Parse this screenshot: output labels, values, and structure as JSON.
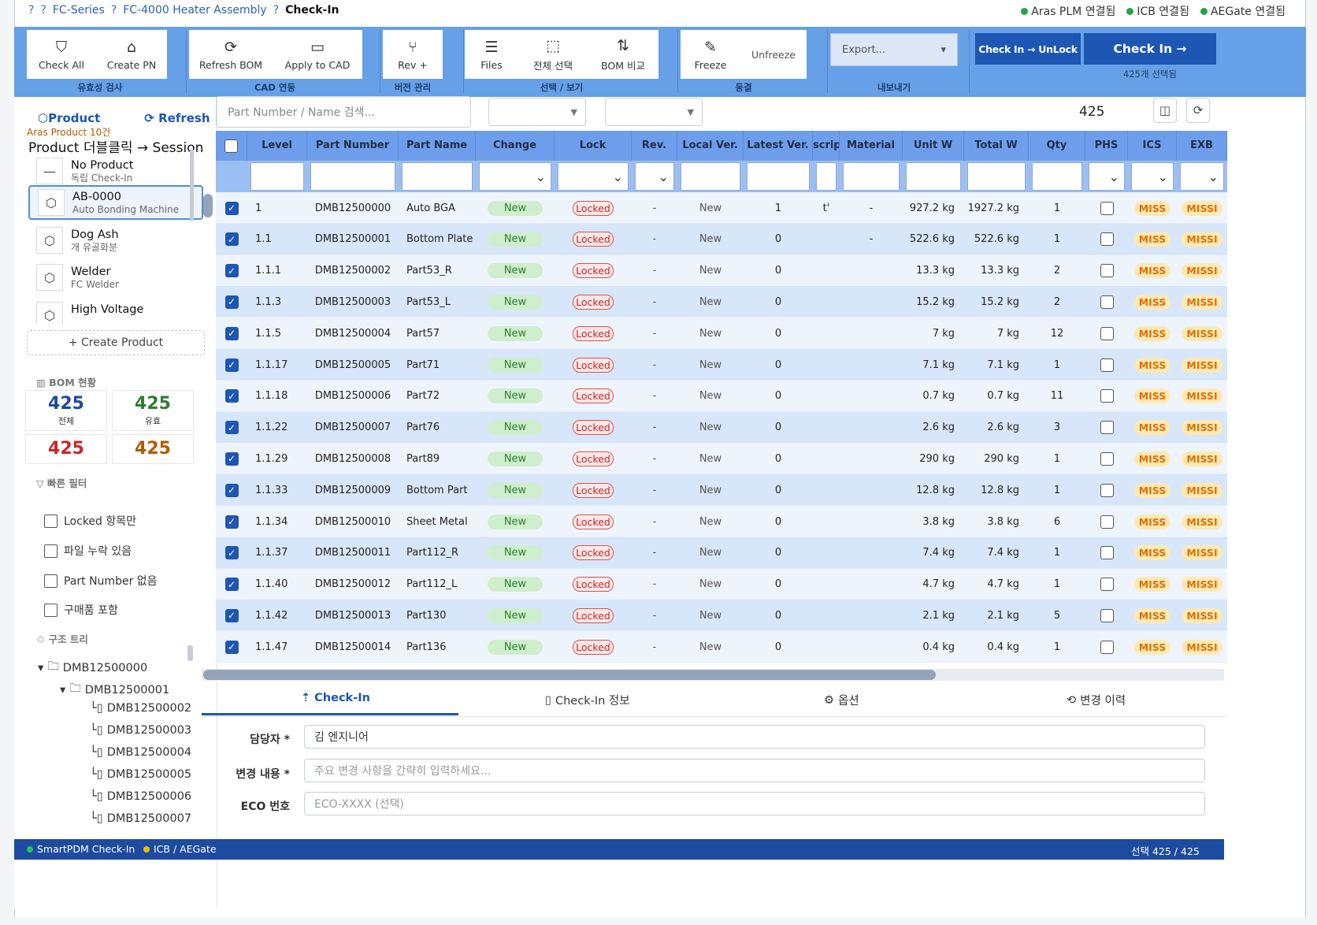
{
  "breadcrumb": {
    "sep": "?",
    "items": [
      "FC-Series",
      "FC-4000 Heater Assembly"
    ],
    "current": "Check-In"
  },
  "connections": [
    {
      "label": "Aras PLM 연결됨",
      "color": "#22a447"
    },
    {
      "label": "ICB 연결됨",
      "color": "#22a447"
    },
    {
      "label": "AEGate 연결됨",
      "color": "#22a447"
    }
  ],
  "ribbon": {
    "validity": {
      "label": "유효성 검사",
      "check_all": "Check All",
      "create_pn": "Create PN"
    },
    "cad": {
      "label": "CAD 연동",
      "refresh_bom": "Refresh BOM",
      "apply_cad": "Apply to CAD"
    },
    "version": {
      "label": "버전 관리",
      "rev_plus": "Rev +"
    },
    "view": {
      "label": "선택 / 보기",
      "files": "Files",
      "select_all": "전체 선택",
      "bom_compare": "BOM 비교"
    },
    "freeze": {
      "label": "동결",
      "freeze": "Freeze",
      "unfreeze": "Unfreeze"
    },
    "export": {
      "label": "내보내기",
      "value": "Export..."
    },
    "checkin_unlock": "Check In → UnLock",
    "checkin": "Check In →",
    "selected_note": "425개 선택됨"
  },
  "sidebar": {
    "product_btn": "Product",
    "refresh_btn": "Refresh",
    "product_count": "Aras Product 10건",
    "hint": "Product 더블클릭 → Session",
    "products": [
      {
        "name": "No Product",
        "desc": "독립 Check-In",
        "icon": "—"
      },
      {
        "name": "AB-0000",
        "desc": "Auto Bonding Machine",
        "icon": "⬡"
      },
      {
        "name": "Dog Ash",
        "desc": "개 유골화분",
        "icon": "⬡"
      },
      {
        "name": "Welder",
        "desc": "FC Welder",
        "icon": "⬡"
      },
      {
        "name": "High Voltage",
        "desc": "",
        "icon": "⬡"
      }
    ],
    "create_product": "+ Create Product",
    "bom_title": "BOM 현황",
    "stats": [
      {
        "value": "425",
        "label": "전체",
        "color": "#1d4b9f"
      },
      {
        "value": "425",
        "label": "유효",
        "color": "#2e7d32"
      },
      {
        "value": "425",
        "label": "",
        "color": "#c62828"
      },
      {
        "value": "425",
        "label": "",
        "color": "#b55a00"
      }
    ],
    "quick_filter_title": "빠른 필터",
    "quick_filters": [
      "Locked 항목만",
      "파일 누락 있음",
      "Part Number 없음",
      "구매품 포함"
    ],
    "tree_title": "구조 트리",
    "tree": [
      "DMB12500000",
      "DMB12500001",
      "DMB12500002",
      "DMB12500003",
      "DMB12500004",
      "DMB12500005",
      "DMB12500006",
      "DMB12500007"
    ]
  },
  "grid": {
    "search_placeholder": "Part Number / Name 검색...",
    "count": "425",
    "columns": [
      "Level",
      "Part Number",
      "Part Name",
      "Change",
      "Lock",
      "Rev.",
      "Local Ver.",
      "Latest Ver.",
      "script",
      "Material",
      "Unit W",
      "Total W",
      "Qty",
      "PHS",
      "ICS",
      "EXB"
    ],
    "rows": [
      {
        "level": "1",
        "pn": "DMB12500000",
        "name": "Auto BGA",
        "change": "New",
        "lock": "Locked",
        "rev": "-",
        "local": "New",
        "latest": "1",
        "script": "t'",
        "mat": "-",
        "unit": "927.2 kg",
        "total": "1927.2 kg",
        "qty": "1",
        "ics": "MISS",
        "exb": "MISSI"
      },
      {
        "level": "1.1",
        "pn": "DMB12500001",
        "name": "Bottom Plate",
        "change": "New",
        "lock": "Locked",
        "rev": "-",
        "local": "New",
        "latest": "0",
        "script": "",
        "mat": "-",
        "unit": "522.6 kg",
        "total": "522.6 kg",
        "qty": "1",
        "ics": "MISS",
        "exb": "MISSI"
      },
      {
        "level": "1.1.1",
        "pn": "DMB12500002",
        "name": "Part53_R",
        "change": "New",
        "lock": "Locked",
        "rev": "-",
        "local": "New",
        "latest": "0",
        "script": "",
        "mat": "",
        "unit": "13.3 kg",
        "total": "13.3 kg",
        "qty": "2",
        "ics": "MISS",
        "exb": "MISSI"
      },
      {
        "level": "1.1.3",
        "pn": "DMB12500003",
        "name": "Part53_L",
        "change": "New",
        "lock": "Locked",
        "rev": "-",
        "local": "New",
        "latest": "0",
        "script": "",
        "mat": "",
        "unit": "15.2 kg",
        "total": "15.2 kg",
        "qty": "2",
        "ics": "MISS",
        "exb": "MISSI"
      },
      {
        "level": "1.1.5",
        "pn": "DMB12500004",
        "name": "Part57",
        "change": "New",
        "lock": "Locked",
        "rev": "-",
        "local": "New",
        "latest": "0",
        "script": "",
        "mat": "",
        "unit": "7 kg",
        "total": "7 kg",
        "qty": "12",
        "ics": "MISS",
        "exb": "MISSI"
      },
      {
        "level": "1.1.17",
        "pn": "DMB12500005",
        "name": "Part71",
        "change": "New",
        "lock": "Locked",
        "rev": "-",
        "local": "New",
        "latest": "0",
        "script": "",
        "mat": "",
        "unit": "7.1 kg",
        "total": "7.1 kg",
        "qty": "1",
        "ics": "MISS",
        "exb": "MISSI"
      },
      {
        "level": "1.1.18",
        "pn": "DMB12500006",
        "name": "Part72",
        "change": "New",
        "lock": "Locked",
        "rev": "-",
        "local": "New",
        "latest": "0",
        "script": "",
        "mat": "",
        "unit": "0.7 kg",
        "total": "0.7 kg",
        "qty": "11",
        "ics": "MISS",
        "exb": "MISSI"
      },
      {
        "level": "1.1.22",
        "pn": "DMB12500007",
        "name": "Part76",
        "change": "New",
        "lock": "Locked",
        "rev": "-",
        "local": "New",
        "latest": "0",
        "script": "",
        "mat": "",
        "unit": "2.6 kg",
        "total": "2.6 kg",
        "qty": "3",
        "ics": "MISS",
        "exb": "MISSI"
      },
      {
        "level": "1.1.29",
        "pn": "DMB12500008",
        "name": "Part89",
        "change": "New",
        "lock": "Locked",
        "rev": "-",
        "local": "New",
        "latest": "0",
        "script": "",
        "mat": "",
        "unit": "290 kg",
        "total": "290 kg",
        "qty": "1",
        "ics": "MISS",
        "exb": "MISSI"
      },
      {
        "level": "1.1.33",
        "pn": "DMB12500009",
        "name": "Bottom Part",
        "change": "New",
        "lock": "Locked",
        "rev": "-",
        "local": "New",
        "latest": "0",
        "script": "",
        "mat": "",
        "unit": "12.8 kg",
        "total": "12.8 kg",
        "qty": "1",
        "ics": "MISS",
        "exb": "MISSI"
      },
      {
        "level": "1.1.34",
        "pn": "DMB12500010",
        "name": "Sheet Metal",
        "change": "New",
        "lock": "Locked",
        "rev": "-",
        "local": "New",
        "latest": "0",
        "script": "",
        "mat": "",
        "unit": "3.8 kg",
        "total": "3.8 kg",
        "qty": "6",
        "ics": "MISS",
        "exb": "MISSI"
      },
      {
        "level": "1.1.37",
        "pn": "DMB12500011",
        "name": "Part112_R",
        "change": "New",
        "lock": "Locked",
        "rev": "-",
        "local": "New",
        "latest": "0",
        "script": "",
        "mat": "",
        "unit": "7.4 kg",
        "total": "7.4 kg",
        "qty": "1",
        "ics": "MISS",
        "exb": "MISSI"
      },
      {
        "level": "1.1.40",
        "pn": "DMB12500012",
        "name": "Part112_L",
        "change": "New",
        "lock": "Locked",
        "rev": "-",
        "local": "New",
        "latest": "0",
        "script": "",
        "mat": "",
        "unit": "4.7 kg",
        "total": "4.7 kg",
        "qty": "1",
        "ics": "MISS",
        "exb": "MISSI"
      },
      {
        "level": "1.1.42",
        "pn": "DMB12500013",
        "name": "Part130",
        "change": "New",
        "lock": "Locked",
        "rev": "-",
        "local": "New",
        "latest": "0",
        "script": "",
        "mat": "",
        "unit": "2.1 kg",
        "total": "2.1 kg",
        "qty": "5",
        "ics": "MISS",
        "exb": "MISSI"
      },
      {
        "level": "1.1.47",
        "pn": "DMB12500014",
        "name": "Part136",
        "change": "New",
        "lock": "Locked",
        "rev": "-",
        "local": "New",
        "latest": "0",
        "script": "",
        "mat": "",
        "unit": "0.4 kg",
        "total": "0.4 kg",
        "qty": "1",
        "ics": "MISS",
        "exb": "MISSI"
      }
    ]
  },
  "tabs": [
    "Check-In",
    "Check-In 정보",
    "옵션",
    "변경 이력"
  ],
  "form": {
    "owner_label": "담당자 *",
    "owner_value": "김 엔지니어",
    "change_label": "변경 내용 *",
    "change_placeholder": "주요 변경 사항을 간략히 입력하세요...",
    "eco_label": "ECO 번호",
    "eco_placeholder": "ECO-XXXX (선택)"
  },
  "status": {
    "left": "SmartPDM Check-In",
    "left_color": "#22c55e",
    "mid": "ICB / AEGate",
    "mid_color": "#f5b800",
    "right": "선택 425 / 425"
  }
}
